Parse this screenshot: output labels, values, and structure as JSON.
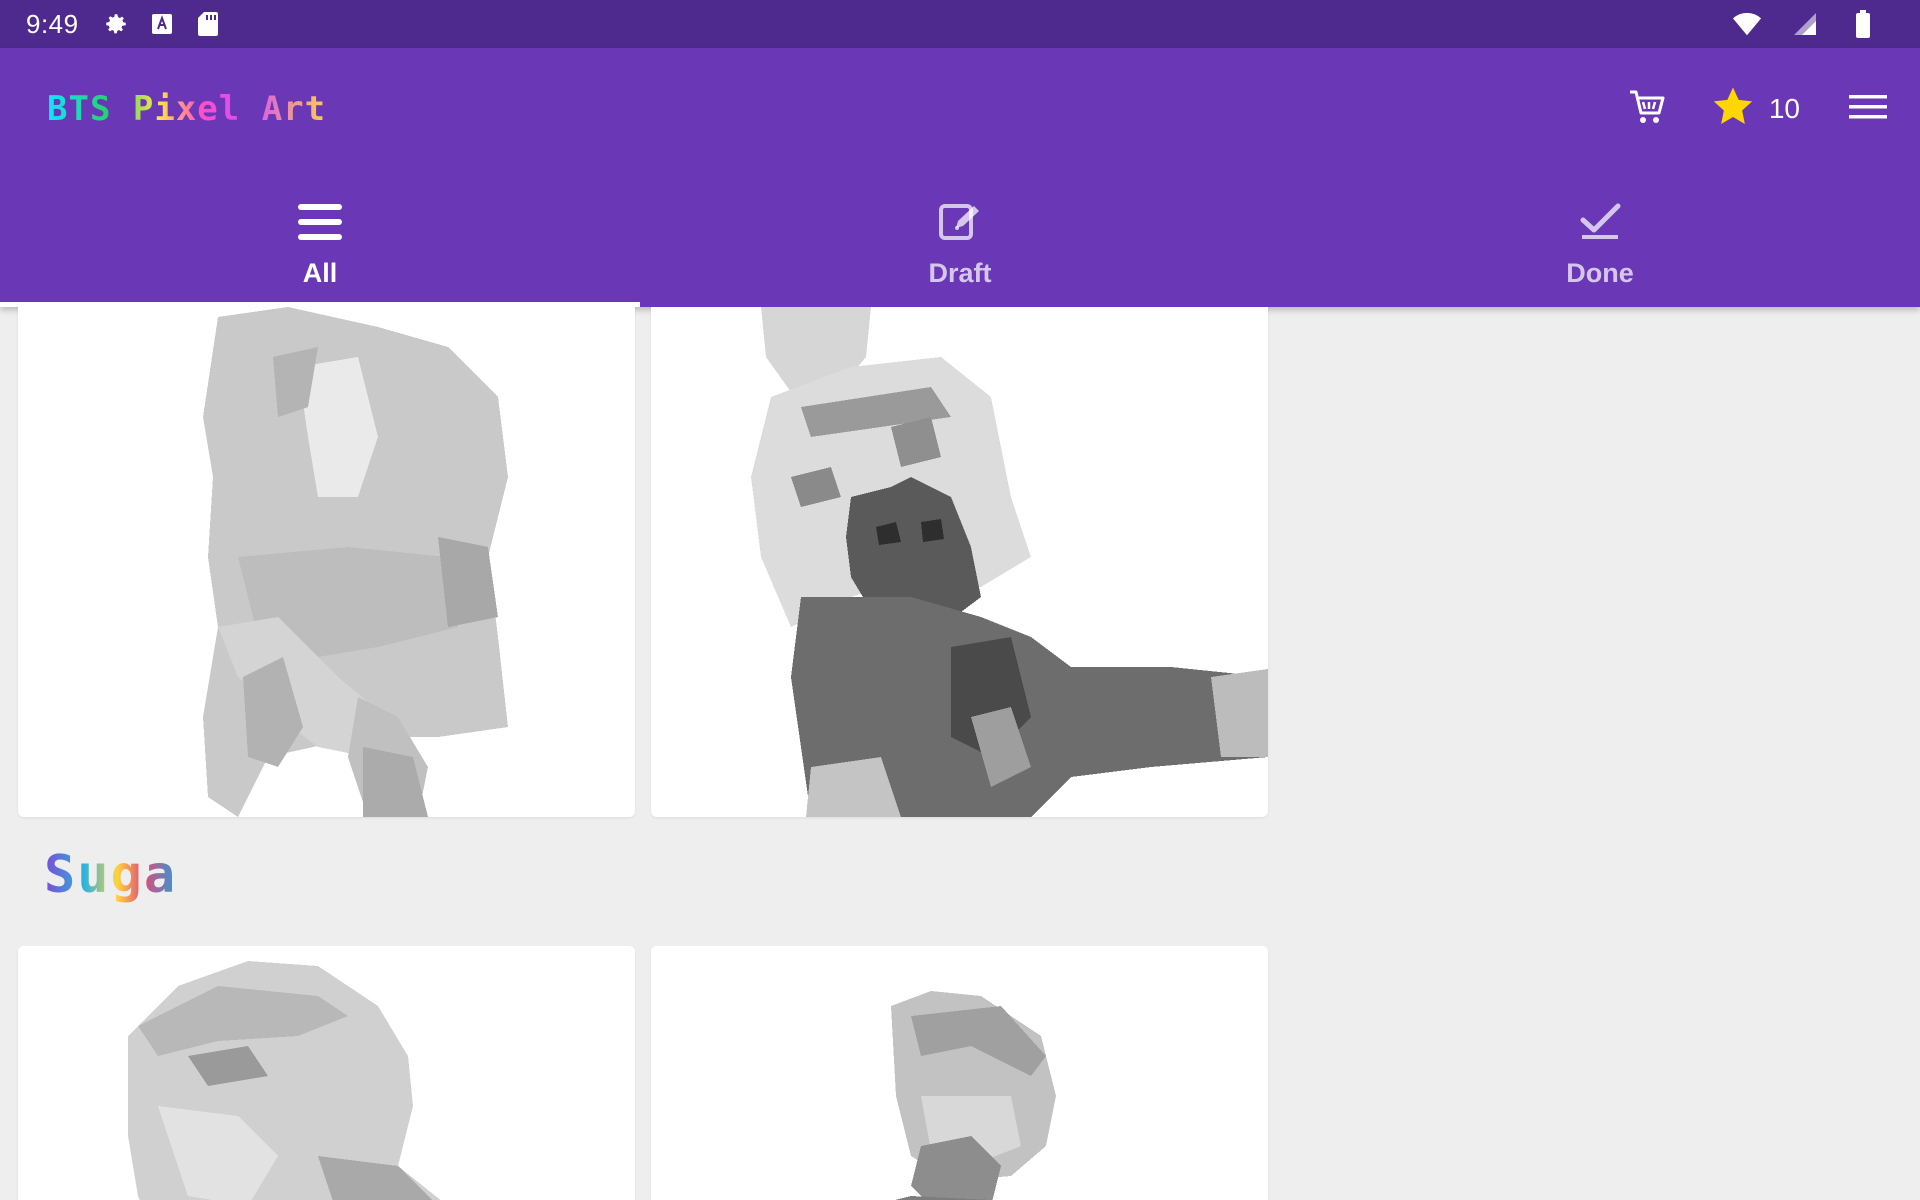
{
  "status_bar": {
    "time": "9:49",
    "icons": [
      "gear-icon",
      "text-a-icon",
      "sd-card-icon"
    ],
    "right_icons": [
      "wifi-icon",
      "signal-icon",
      "battery-icon"
    ]
  },
  "app": {
    "title": "BTS Pixel Art",
    "stars": "10",
    "actions": [
      "cart-icon",
      "star-icon",
      "menu-icon"
    ]
  },
  "tabs": [
    {
      "label": "All",
      "icon": "list-icon",
      "active": true
    },
    {
      "label": "Draft",
      "icon": "edit-icon",
      "active": false
    },
    {
      "label": "Done",
      "icon": "check-icon",
      "active": false
    }
  ],
  "sections": [
    {
      "title": "Suga"
    }
  ],
  "colors": {
    "status_bar": "#4e2a8e",
    "app_bar": "#6a37b6",
    "background": "#eeeeee",
    "card": "#ffffff",
    "star": "#ffd600"
  }
}
